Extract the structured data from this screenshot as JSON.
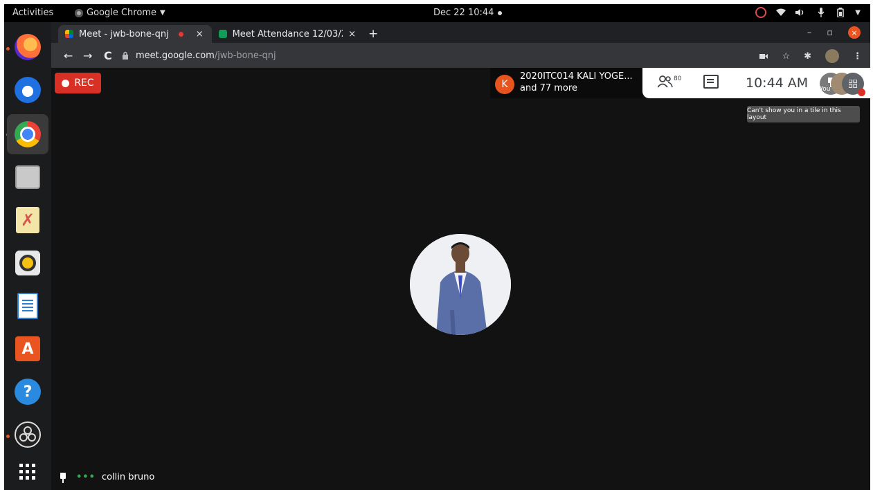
{
  "topbar": {
    "activities": "Activities",
    "app_name": "Google Chrome",
    "app_menu_arrow": "▼",
    "clock": "Dec 22  10:44",
    "tray_icons": [
      "ubuntu-update-icon",
      "wifi-icon",
      "volume-icon",
      "mic-icon",
      "battery-icon",
      "system-menu-arrow-icon"
    ]
  },
  "dock": {
    "items": [
      {
        "name": "firefox",
        "glyph": ""
      },
      {
        "name": "thunderbird",
        "glyph": ""
      },
      {
        "name": "chrome",
        "glyph": ""
      },
      {
        "name": "files",
        "glyph": ""
      },
      {
        "name": "text-editor",
        "glyph": "✗"
      },
      {
        "name": "rhythmbox",
        "glyph": ""
      },
      {
        "name": "libreoffice-writer",
        "glyph": ""
      },
      {
        "name": "software",
        "glyph": "A"
      },
      {
        "name": "help",
        "glyph": "?"
      },
      {
        "name": "obs",
        "glyph": ""
      },
      {
        "name": "show-apps",
        "glyph": "⠿"
      }
    ]
  },
  "chrome": {
    "tabs": [
      {
        "title": "Meet - jwb-bone-qnj",
        "active": true
      },
      {
        "title": "Meet Attendance 12/03/2",
        "active": false
      }
    ],
    "tab_close": "×",
    "new_tab": "+",
    "url_host": "meet.google.com",
    "url_path": "/jwb-bone-qnj",
    "nav": {
      "back": "←",
      "forward": "→",
      "reload": "C"
    },
    "window": {
      "minimize": "–",
      "restore": "▫",
      "close": "×"
    },
    "tools": {
      "star": "☆",
      "extensions": "✱",
      "menu": "⋮"
    }
  },
  "meet": {
    "rec_label": "REC",
    "speaker_initial": "K",
    "speaker_name": "2020ITC014 KALI YOGE...",
    "speaker_more": "and 77 more",
    "participants_count": "80",
    "time": "10:44 AM",
    "you_label": "You",
    "tooltip": "Can't show you in a tile in this layout",
    "presenter_name": "collin bruno",
    "presenter_dots": "•••"
  },
  "colors": {
    "rec": "#d93025",
    "speaker_avatar": "#e8541d",
    "ubuntu_orange": "#e95420",
    "meet_bg": "#121212"
  }
}
